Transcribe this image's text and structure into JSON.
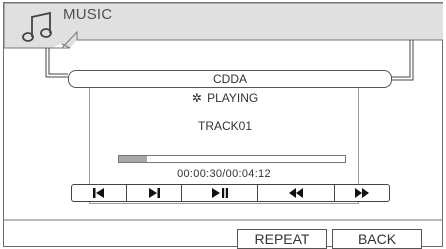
{
  "header": {
    "title": "MUSIC",
    "icon": "music-note-icon"
  },
  "player": {
    "source": "CDDA",
    "status_icon": "gear-icon",
    "status_glyph": "✲",
    "status": "PLAYING",
    "track": "TRACK01",
    "progress_fraction": 0.125,
    "time": "00:00:30/00:04:12"
  },
  "controls": {
    "items": [
      "previous-track",
      "next-track",
      "play-pause",
      "rewind",
      "fast-forward"
    ]
  },
  "footer": {
    "repeat_label": "REPEAT",
    "back_label": "BACK"
  }
}
